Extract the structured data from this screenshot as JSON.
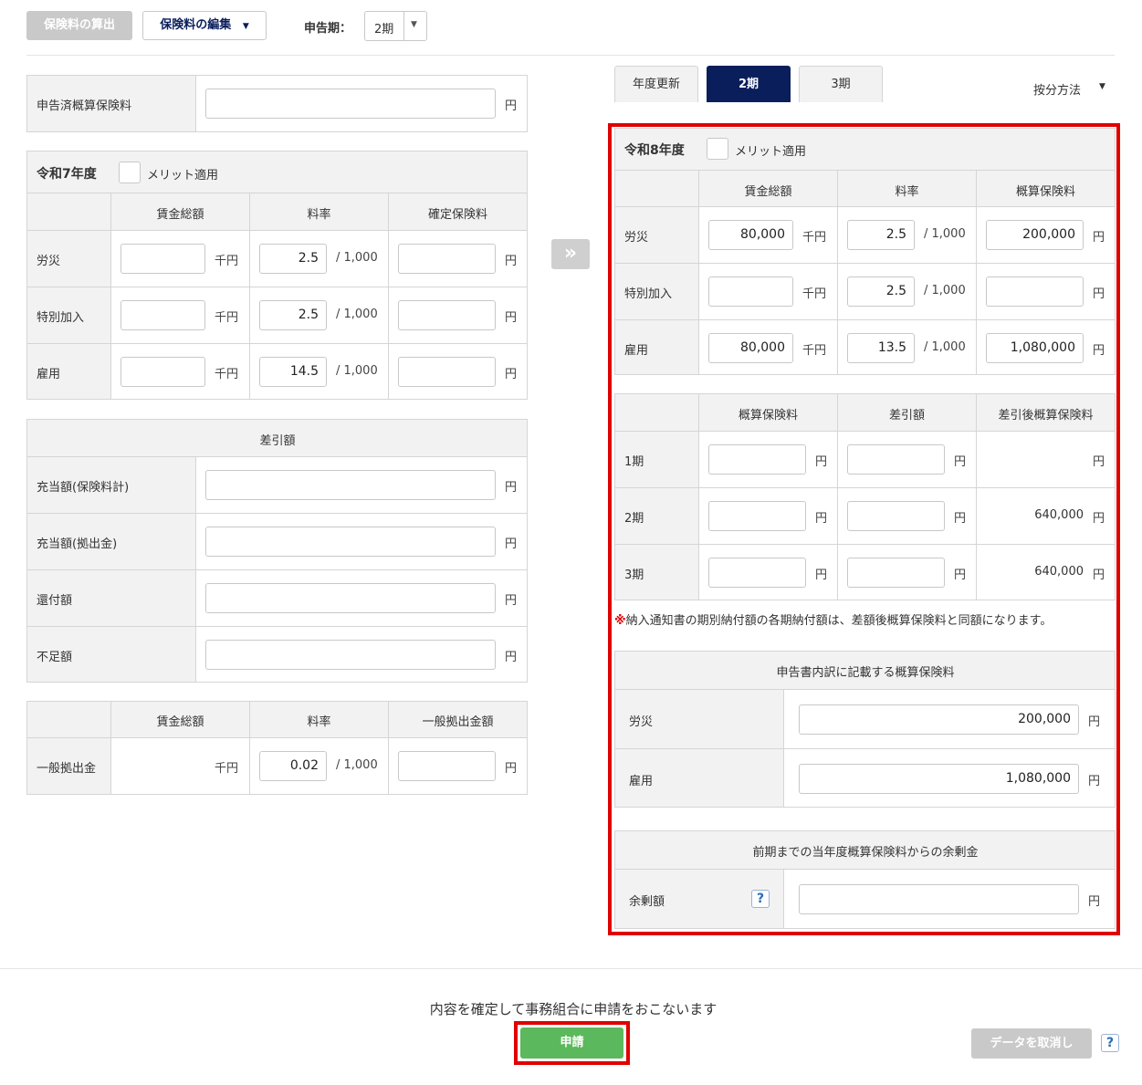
{
  "toolbar": {
    "calc_button": "保険料の算出",
    "edit_button": "保険料の編集",
    "period_label": "申告期：",
    "period_value": "2期"
  },
  "left": {
    "declared": {
      "label": "申告済概算保険料",
      "unit": "円"
    },
    "r7": {
      "title": "令和7年度",
      "merit": "メリット適用",
      "headers": [
        "賃金総額",
        "料率",
        "確定保険料"
      ],
      "rows": [
        {
          "label": "労災",
          "wage_unit": "千円",
          "rate": "2.5",
          "rate_unit": "/ 1,000",
          "amount_unit": "円"
        },
        {
          "label": "特別加入",
          "wage_unit": "千円",
          "rate": "2.5",
          "rate_unit": "/ 1,000",
          "amount_unit": "円"
        },
        {
          "label": "雇用",
          "wage_unit": "千円",
          "rate": "14.5",
          "rate_unit": "/ 1,000",
          "amount_unit": "円"
        }
      ]
    },
    "diff": {
      "title": "差引額",
      "rows": [
        {
          "label": "充当額(保険料計)",
          "unit": "円"
        },
        {
          "label": "充当額(拠出金)",
          "unit": "円"
        },
        {
          "label": "還付額",
          "unit": "円"
        },
        {
          "label": "不足額",
          "unit": "円"
        }
      ]
    },
    "general": {
      "headers": [
        "賃金総額",
        "料率",
        "一般拠出金額"
      ],
      "label": "一般拠出金",
      "wage_unit": "千円",
      "rate": "0.02",
      "rate_unit": "/ 1,000",
      "amount_unit": "円"
    }
  },
  "arrow": "»",
  "tabs": [
    "年度更新",
    "2期",
    "3期"
  ],
  "allocation": "按分方法",
  "right": {
    "r8": {
      "title": "令和8年度",
      "merit": "メリット適用",
      "headers": [
        "賃金総額",
        "料率",
        "概算保険料"
      ],
      "rows": [
        {
          "label": "労災",
          "wage": "80,000",
          "wage_unit": "千円",
          "rate": "2.5",
          "rate_unit": "/ 1,000",
          "amount": "200,000",
          "amount_unit": "円"
        },
        {
          "label": "特別加入",
          "wage": "",
          "wage_unit": "千円",
          "rate": "2.5",
          "rate_unit": "/ 1,000",
          "amount": "",
          "amount_unit": "円"
        },
        {
          "label": "雇用",
          "wage": "80,000",
          "wage_unit": "千円",
          "rate": "13.5",
          "rate_unit": "/ 1,000",
          "amount": "1,080,000",
          "amount_unit": "円"
        }
      ]
    },
    "period": {
      "headers": [
        "概算保険料",
        "差引額",
        "差引後概算保険料"
      ],
      "rows": [
        {
          "label": "1期",
          "unit": "円",
          "after": ""
        },
        {
          "label": "2期",
          "unit": "円",
          "after": "640,000"
        },
        {
          "label": "3期",
          "unit": "円",
          "after": "640,000"
        }
      ]
    },
    "note_mark": "※",
    "note": "納入通知書の期別納付額の各期納付額は、差額後概算保険料と同額になります。",
    "declared_title": "申告書内訳に記載する概算保険料",
    "declared_rows": [
      {
        "label": "労災",
        "value": "200,000",
        "unit": "円"
      },
      {
        "label": "雇用",
        "value": "1,080,000",
        "unit": "円"
      }
    ],
    "surplus_title": "前期までの当年度概算保険料からの余剰金",
    "surplus": {
      "label": "余剰額",
      "help": "?",
      "unit": "円"
    }
  },
  "footer": {
    "message": "内容を確定して事務組合に申請をおこないます",
    "apply_button": "申請",
    "cancel_button": "データを取消し",
    "help": "?"
  },
  "colors": {
    "green": "#5cb85c",
    "red_highlight": "#e00000",
    "navy": "#0a1e5c",
    "disabled": "#c9c9c9"
  }
}
